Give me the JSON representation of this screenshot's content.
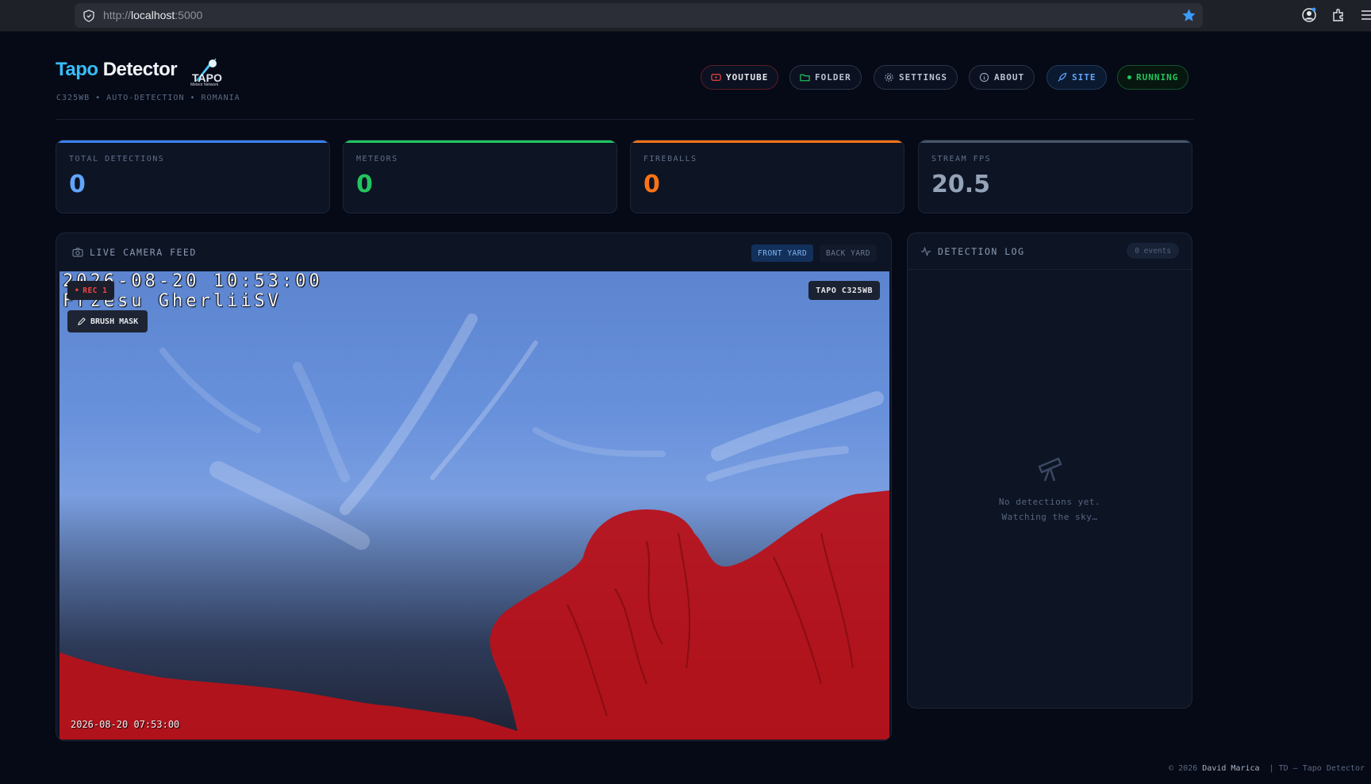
{
  "browser": {
    "url_scheme": "http://",
    "url_host": "localhost",
    "url_port": ":5000"
  },
  "header": {
    "brand_part1": "Tapo",
    "brand_part2": "Detector",
    "logo_text": "TAPO",
    "logo_sub": "Meteor Network",
    "subtitle": "C325WB • AUTO-DETECTION • ROMANIA"
  },
  "nav": {
    "youtube": "YOUTUBE",
    "folder": "FOLDER",
    "settings": "SETTINGS",
    "about": "ABOUT",
    "site": "SITE",
    "status": "RUNNING"
  },
  "stats": {
    "total": {
      "label": "TOTAL DETECTIONS",
      "value": "0",
      "color": "#60a5fa"
    },
    "meteors": {
      "label": "METEORS",
      "value": "0",
      "color": "#22c55e"
    },
    "fireballs": {
      "label": "FIREBALLS",
      "value": "0",
      "color": "#f97316"
    },
    "fps": {
      "label": "STREAM FPS",
      "value": "20.5",
      "color": "#94a3b8"
    }
  },
  "camera": {
    "title": "LIVE CAMERA FEED",
    "tabs": [
      "FRONT YARD",
      "BACK YARD"
    ],
    "active_tab": "FRONT YARD",
    "osd_line1": "2026-08-20 10:53:00",
    "osd_line2": "Frzesu GherliiSV",
    "rec_badge": "REC 1",
    "brush_button": "BRUSH MASK",
    "model_badge": "TAPO C325WB",
    "timestamp": "2026-08-20 07:53:00",
    "mask_color": "#b8121a"
  },
  "log": {
    "title": "DETECTION LOG",
    "count": "0 events",
    "empty_line1": "No detections yet.",
    "empty_line2": "Watching the sky…"
  },
  "footer": {
    "copyright": "© 2026",
    "author": "David Marica",
    "app": "| TD — Tapo Detector"
  }
}
